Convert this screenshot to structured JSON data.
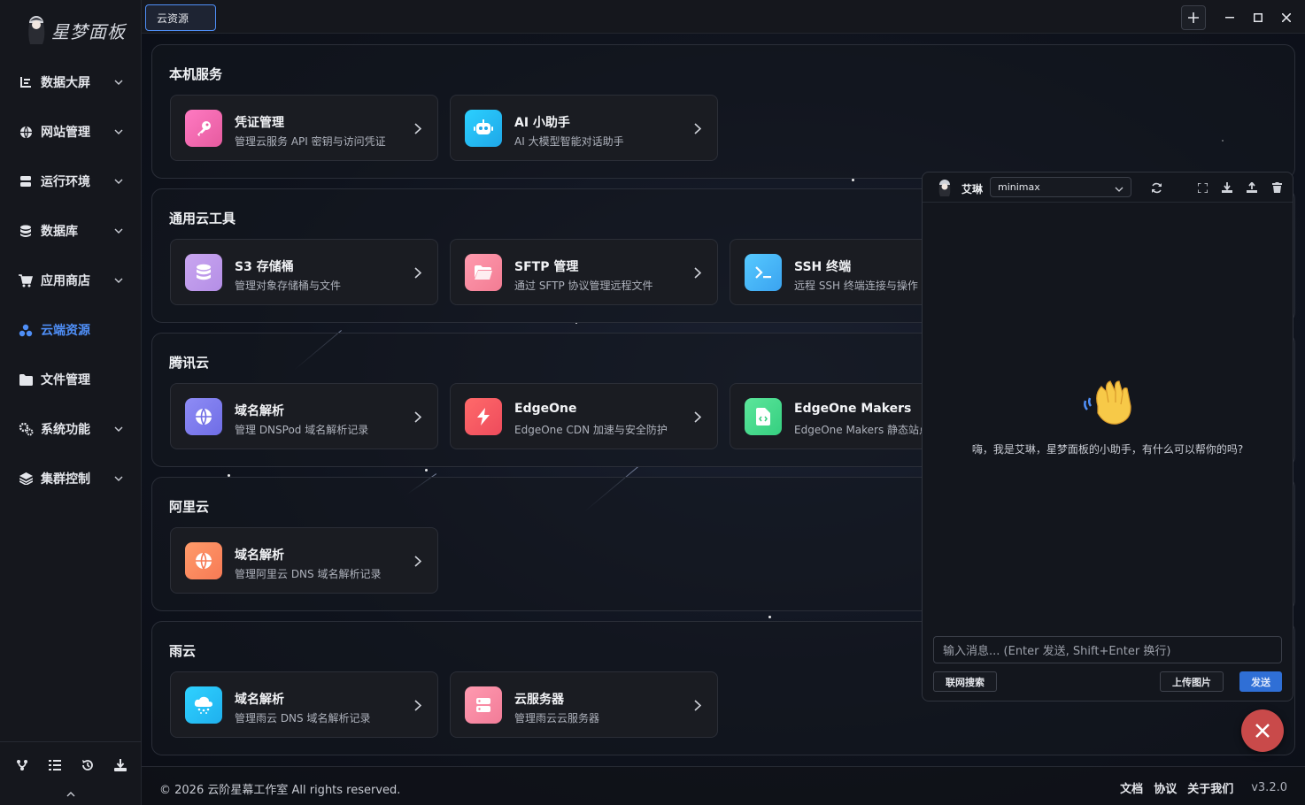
{
  "app": {
    "logo_text": "星梦面板"
  },
  "sidebar": {
    "items": [
      {
        "label": "数据大屏",
        "icon": "chart-icon",
        "has_chevron": true
      },
      {
        "label": "网站管理",
        "icon": "globe-icon",
        "has_chevron": true
      },
      {
        "label": "运行环境",
        "icon": "server-icon",
        "has_chevron": true
      },
      {
        "label": "数据库",
        "icon": "database-icon",
        "has_chevron": true
      },
      {
        "label": "应用商店",
        "icon": "cart-icon",
        "has_chevron": true
      },
      {
        "label": "云端资源",
        "icon": "cloud-nodes-icon",
        "has_chevron": false,
        "active": true
      },
      {
        "label": "文件管理",
        "icon": "folder-icon",
        "has_chevron": false
      },
      {
        "label": "系统功能",
        "icon": "gears-icon",
        "has_chevron": true
      },
      {
        "label": "集群控制",
        "icon": "layers-icon",
        "has_chevron": true
      }
    ],
    "footer_icons": [
      "branch-icon",
      "list-icon",
      "history-icon",
      "download-icon"
    ],
    "collapse_icon": "chevron-up-icon"
  },
  "topbar": {
    "tab_label": "云资源",
    "buttons": [
      "plus-icon",
      "minimize-icon",
      "maximize-icon",
      "close-icon"
    ]
  },
  "sections": [
    {
      "title": "本机服务",
      "cards": [
        {
          "title": "凭证管理",
          "desc": "管理云服务 API 密钥与访问凭证",
          "icon": "key-icon",
          "color_from": "#ff7ac2",
          "color_to": "#e65b9f"
        },
        {
          "title": "AI 小助手",
          "desc": "AI 大模型智能对话助手",
          "icon": "robot-icon",
          "color_from": "#2bd0ff",
          "color_to": "#1fa7e8"
        }
      ]
    },
    {
      "title": "通用云工具",
      "cards": [
        {
          "title": "S3 存储桶",
          "desc": "管理对象存储桶与文件",
          "icon": "database-icon",
          "color_from": "#c9a6f0",
          "color_to": "#b48ee6"
        },
        {
          "title": "SFTP 管理",
          "desc": "通过 SFTP 协议管理远程文件",
          "icon": "folder-open-icon",
          "color_from": "#ff9aae",
          "color_to": "#f27c93"
        },
        {
          "title": "SSH 终端",
          "desc": "远程 SSH 终端连接与操作",
          "icon": "terminal-icon",
          "color_from": "#56c9ff",
          "color_to": "#3aa3f0"
        }
      ]
    },
    {
      "title": "腾讯云",
      "cards": [
        {
          "title": "域名解析",
          "desc": "管理 DNSPod 域名解析记录",
          "icon": "globe-icon",
          "color_from": "#8e8cf5",
          "color_to": "#6f6de6"
        },
        {
          "title": "EdgeOne",
          "desc": "EdgeOne CDN 加速与安全防护",
          "icon": "bolt-icon",
          "color_from": "#ff6a6a",
          "color_to": "#ee4b5c"
        },
        {
          "title": "EdgeOne Makers",
          "desc": "EdgeOne Makers 静态站点部署",
          "icon": "code-file-icon",
          "color_from": "#5ce69b",
          "color_to": "#35cf80"
        }
      ]
    },
    {
      "title": "阿里云",
      "cards": [
        {
          "title": "域名解析",
          "desc": "管理阿里云 DNS 域名解析记录",
          "icon": "globe-icon",
          "color_from": "#ff9b6a",
          "color_to": "#f77a55"
        }
      ]
    },
    {
      "title": "雨云",
      "cards": [
        {
          "title": "域名解析",
          "desc": "管理雨云 DNS 域名解析记录",
          "icon": "cloud-rain-icon",
          "color_from": "#2fd2ff",
          "color_to": "#1fb0ee"
        },
        {
          "title": "云服务器",
          "desc": "管理雨云云服务器",
          "icon": "server-icon",
          "color_from": "#ff9ab0",
          "color_to": "#f27c98"
        }
      ]
    }
  ],
  "footer": {
    "copyright": "© 2026 云阶星幕工作室 All rights reserved.",
    "links": [
      "文档",
      "协议",
      "关于我们"
    ],
    "version": "v3.2.0"
  },
  "chat": {
    "assistant_name": "艾琳",
    "model": "minimax",
    "greeting": "嗨，我是艾琳，星梦面板的小助手，有什么可以帮你的吗?",
    "input_placeholder": "输入消息... (Enter 发送, Shift+Enter 换行)",
    "web_search_label": "联网搜索",
    "upload_image_label": "上传图片",
    "send_label": "发送",
    "tool_icons": [
      "refresh-icon",
      "fullscreen-icon",
      "download-icon",
      "upload-icon",
      "trash-icon"
    ]
  },
  "colors": {
    "accent": "#4f8ff7",
    "send_button": "#2f6fd6",
    "close_fab": "#c94a4a"
  }
}
